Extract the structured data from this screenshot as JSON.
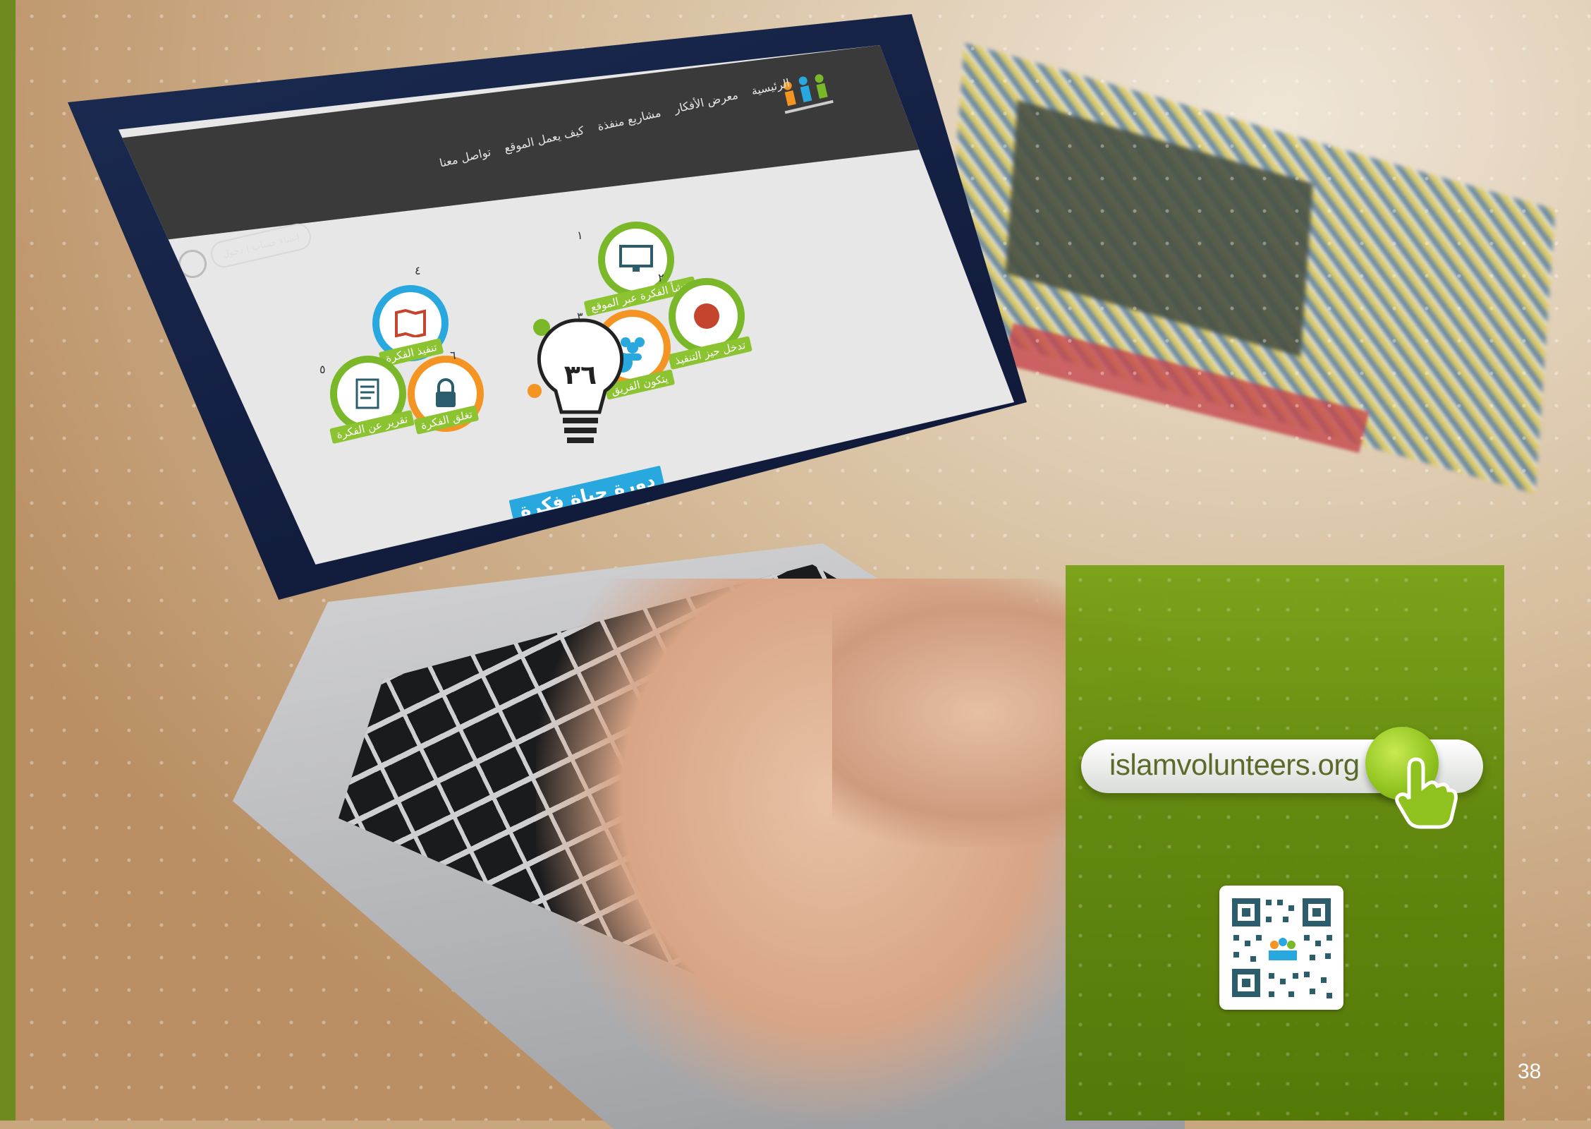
{
  "page": {
    "number": "38"
  },
  "colors": {
    "brand_green": "#7ab829",
    "accent_blue": "#29a8df",
    "accent_orange": "#f39423",
    "panel_green": "#6f9e14"
  },
  "website": {
    "nav": [
      "الرئيسية",
      "معرض الأفكار",
      "مشاريع منفذة",
      "كيف يعمل الموقع",
      "تواصل معنا"
    ],
    "login": "إنشاء حساب | دخول",
    "center_title": "دورة حياة فكرة",
    "center_number": "٣٦",
    "steps": [
      {
        "num": "١",
        "label": "تنشأ الفكرة عبر الموقع",
        "icon": "monitor-icon"
      },
      {
        "num": "٢",
        "label": "تدخل حيز التنفيذ",
        "icon": "globe-network-icon"
      },
      {
        "num": "٣",
        "label": "يتكون الفريق",
        "icon": "team-icon"
      },
      {
        "num": "٤",
        "label": "تنفيذ الفكرة",
        "icon": "map-icon"
      },
      {
        "num": "٥",
        "label": "تقرير عن الفكرة",
        "icon": "report-icon"
      },
      {
        "num": "٦",
        "label": "تغلق الفكرة",
        "icon": "lock-icon"
      }
    ]
  },
  "callout": {
    "url": "islamvolunteers.org",
    "button_icon": "hand-pointer-icon",
    "qr_icon": "qr-code-icon"
  }
}
